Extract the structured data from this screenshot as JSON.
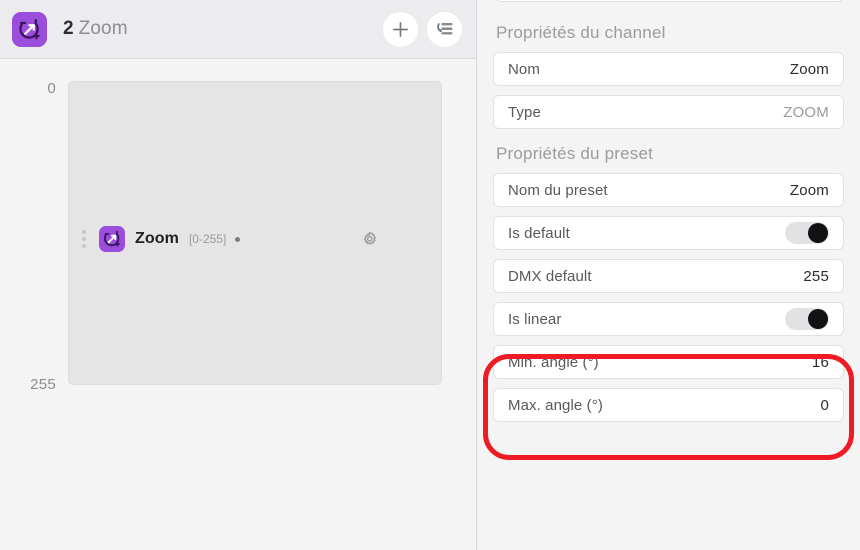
{
  "left": {
    "header": {
      "channel_number": "2",
      "channel_name": "Zoom",
      "icon": "zoom-channel-icon",
      "add_button_icon": "plus-icon",
      "sort_button_icon": "reorder-list-icon"
    },
    "scale": {
      "top_label": "0",
      "bottom_label": "255"
    },
    "row": {
      "icon": "zoom-channel-icon",
      "name": "Zoom",
      "range": "[0-255]",
      "status_dot": "status-dot",
      "drag_handle_icon": "drag-handle-icon",
      "settings_icon": "gear-icon"
    }
  },
  "right": {
    "channel_section_title": "Propriétés du channel",
    "preset_section_title": "Propriétés du preset",
    "channel_props": [
      {
        "label": "Nom",
        "value": "Zoom",
        "type": "text",
        "muted": false
      },
      {
        "label": "Type",
        "value": "ZOOM",
        "type": "text",
        "muted": true
      }
    ],
    "preset_props": [
      {
        "label": "Nom du preset",
        "value": "Zoom",
        "type": "text",
        "muted": false
      },
      {
        "label": "Is default",
        "value": "on",
        "type": "toggle",
        "muted": false
      },
      {
        "label": "DMX default",
        "value": "255",
        "type": "text",
        "muted": false
      },
      {
        "label": "Is linear",
        "value": "on",
        "type": "toggle",
        "muted": false
      },
      {
        "label": "Min. angle (°)",
        "value": "16",
        "type": "text",
        "muted": false
      },
      {
        "label": "Max. angle (°)",
        "value": "0",
        "type": "text",
        "muted": false
      }
    ],
    "highlight_color": "#ee1b24"
  },
  "colors": {
    "accent_purple": "#9b4ddb",
    "page_background": "#f4f4f5",
    "header_background": "#ececee",
    "range_box": "#e5e5e6",
    "annotation_red": "#ee1b24"
  }
}
